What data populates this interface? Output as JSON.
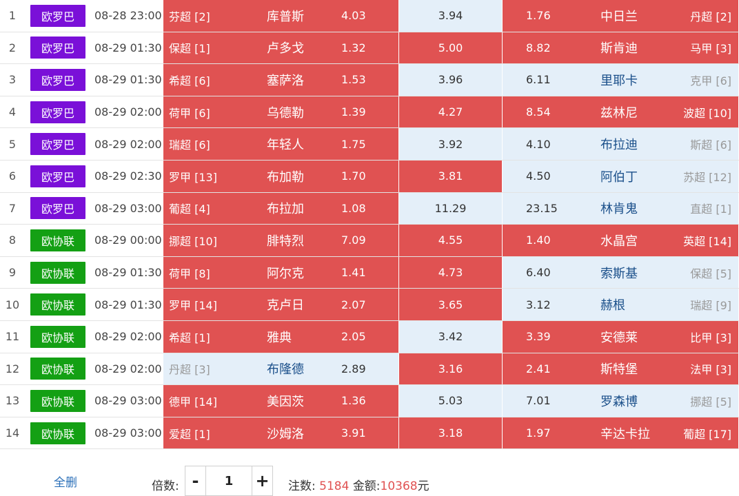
{
  "colors": {
    "selected": "#e05252",
    "unselected": "#e4eff9",
    "europa_league": "#7a10d8",
    "conference_league": "#14a014"
  },
  "matches": [
    {
      "idx": "1",
      "comp": "欧罗巴",
      "comp_type": "ely",
      "time": "08-28 23:00",
      "home": {
        "league": "芬超 [2]",
        "team": "库普斯",
        "odd": "4.03",
        "sel": true
      },
      "draw": {
        "odd": "3.94",
        "sel": false
      },
      "away": {
        "odd": "1.76",
        "team": "中日兰",
        "league": "丹超 [2]",
        "sel": true
      }
    },
    {
      "idx": "2",
      "comp": "欧罗巴",
      "comp_type": "ely",
      "time": "08-29 01:30",
      "home": {
        "league": "保超 [1]",
        "team": "卢多戈",
        "odd": "1.32",
        "sel": true
      },
      "draw": {
        "odd": "5.00",
        "sel": true
      },
      "away": {
        "odd": "8.82",
        "team": "斯肯迪",
        "league": "马甲 [3]",
        "sel": true
      }
    },
    {
      "idx": "3",
      "comp": "欧罗巴",
      "comp_type": "ely",
      "time": "08-29 01:30",
      "home": {
        "league": "希超 [6]",
        "team": "塞萨洛",
        "odd": "1.53",
        "sel": true
      },
      "draw": {
        "odd": "3.96",
        "sel": false
      },
      "away": {
        "odd": "6.11",
        "team": "里耶卡",
        "league": "克甲 [6]",
        "sel": false
      }
    },
    {
      "idx": "4",
      "comp": "欧罗巴",
      "comp_type": "ely",
      "time": "08-29 02:00",
      "home": {
        "league": "荷甲 [6]",
        "team": "乌德勒",
        "odd": "1.39",
        "sel": true
      },
      "draw": {
        "odd": "4.27",
        "sel": true
      },
      "away": {
        "odd": "8.54",
        "team": "兹林尼",
        "league": "波超 [10]",
        "sel": true
      }
    },
    {
      "idx": "5",
      "comp": "欧罗巴",
      "comp_type": "ely",
      "time": "08-29 02:00",
      "home": {
        "league": "瑞超 [6]",
        "team": "年轻人",
        "odd": "1.75",
        "sel": true
      },
      "draw": {
        "odd": "3.92",
        "sel": false
      },
      "away": {
        "odd": "4.10",
        "team": "布拉迪",
        "league": "斯超 [6]",
        "sel": false
      }
    },
    {
      "idx": "6",
      "comp": "欧罗巴",
      "comp_type": "ely",
      "time": "08-29 02:30",
      "home": {
        "league": "罗甲 [13]",
        "team": "布加勒",
        "odd": "1.70",
        "sel": true
      },
      "draw": {
        "odd": "3.81",
        "sel": true
      },
      "away": {
        "odd": "4.50",
        "team": "阿伯丁",
        "league": "苏超 [12]",
        "sel": false
      }
    },
    {
      "idx": "7",
      "comp": "欧罗巴",
      "comp_type": "ely",
      "time": "08-29 03:00",
      "home": {
        "league": "葡超 [4]",
        "team": "布拉加",
        "odd": "1.08",
        "sel": true
      },
      "draw": {
        "odd": "11.29",
        "sel": false
      },
      "away": {
        "odd": "23.15",
        "team": "林肯鬼",
        "league": "直超 [1]",
        "sel": false
      }
    },
    {
      "idx": "8",
      "comp": "欧协联",
      "comp_type": "eyl",
      "time": "08-29 00:00",
      "home": {
        "league": "挪超 [10]",
        "team": "腓特烈",
        "odd": "7.09",
        "sel": true
      },
      "draw": {
        "odd": "4.55",
        "sel": true
      },
      "away": {
        "odd": "1.40",
        "team": "水晶宫",
        "league": "英超 [14]",
        "sel": true
      }
    },
    {
      "idx": "9",
      "comp": "欧协联",
      "comp_type": "eyl",
      "time": "08-29 01:30",
      "home": {
        "league": "荷甲 [8]",
        "team": "阿尔克",
        "odd": "1.41",
        "sel": true
      },
      "draw": {
        "odd": "4.73",
        "sel": true
      },
      "away": {
        "odd": "6.40",
        "team": "索斯基",
        "league": "保超 [5]",
        "sel": false
      }
    },
    {
      "idx": "10",
      "comp": "欧协联",
      "comp_type": "eyl",
      "time": "08-29 01:30",
      "home": {
        "league": "罗甲 [14]",
        "team": "克卢日",
        "odd": "2.07",
        "sel": true
      },
      "draw": {
        "odd": "3.65",
        "sel": true
      },
      "away": {
        "odd": "3.12",
        "team": "赫根",
        "league": "瑞超 [9]",
        "sel": false
      }
    },
    {
      "idx": "11",
      "comp": "欧协联",
      "comp_type": "eyl",
      "time": "08-29 02:00",
      "home": {
        "league": "希超 [1]",
        "team": "雅典",
        "odd": "2.05",
        "sel": true
      },
      "draw": {
        "odd": "3.42",
        "sel": false
      },
      "away": {
        "odd": "3.39",
        "team": "安德莱",
        "league": "比甲 [3]",
        "sel": true
      }
    },
    {
      "idx": "12",
      "comp": "欧协联",
      "comp_type": "eyl",
      "time": "08-29 02:00",
      "home": {
        "league": "丹超 [3]",
        "team": "布隆德",
        "odd": "2.89",
        "sel": false
      },
      "draw": {
        "odd": "3.16",
        "sel": true
      },
      "away": {
        "odd": "2.41",
        "team": "斯特堡",
        "league": "法甲 [3]",
        "sel": true
      }
    },
    {
      "idx": "13",
      "comp": "欧协联",
      "comp_type": "eyl",
      "time": "08-29 03:00",
      "home": {
        "league": "德甲 [14]",
        "team": "美因茨",
        "odd": "1.36",
        "sel": true
      },
      "draw": {
        "odd": "5.03",
        "sel": false
      },
      "away": {
        "odd": "7.01",
        "team": "罗森博",
        "league": "挪超 [5]",
        "sel": false
      }
    },
    {
      "idx": "14",
      "comp": "欧协联",
      "comp_type": "eyl",
      "time": "08-29 03:00",
      "home": {
        "league": "爱超 [1]",
        "team": "沙姆洛",
        "odd": "3.91",
        "sel": true
      },
      "draw": {
        "odd": "3.18",
        "sel": true
      },
      "away": {
        "odd": "1.97",
        "team": "辛达卡拉",
        "league": "葡超 [17]",
        "sel": true
      }
    }
  ],
  "footer": {
    "clear_label": "全删",
    "multiplier_label": "倍数:",
    "multiplier_value": "1",
    "minus_label": "-",
    "plus_label": "+",
    "bets_label": "注数:",
    "bets_value": "5184",
    "amount_label": "金额:",
    "amount_value": "10368",
    "amount_unit": "元"
  }
}
